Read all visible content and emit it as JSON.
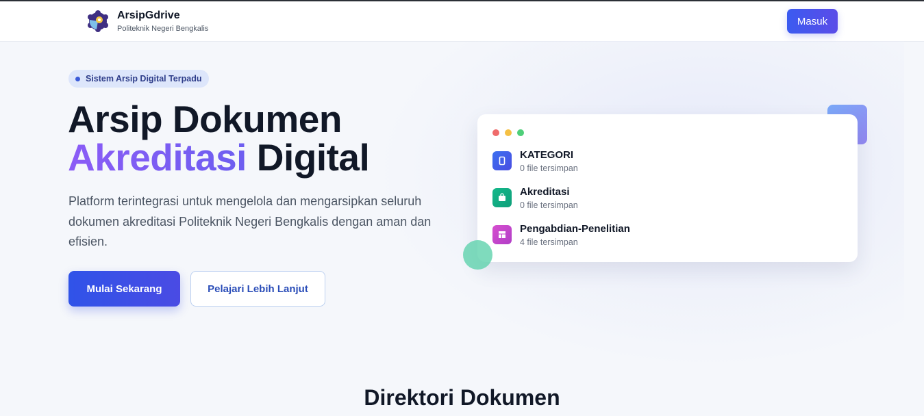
{
  "header": {
    "brand_title": "ArsipGdrive",
    "brand_subtitle": "Politeknik Negeri Bengkalis",
    "login_label": "Masuk"
  },
  "hero": {
    "badge": "Sistem Arsip Digital Terpadu",
    "title_line1": "Arsip Dokumen",
    "title_accent": "Akreditasi",
    "title_line2_rest": "Digital",
    "description": "Platform terintegrasi untuk mengelola dan mengarsipkan seluruh dokumen akreditasi Politeknik Negeri Bengkalis dengan aman dan efisien.",
    "primary_cta": "Mulai Sekarang",
    "secondary_cta": "Pelajari Lebih Lanjut"
  },
  "preview_card": {
    "items": [
      {
        "name": "KATEGORI",
        "count": "0 file tersimpan",
        "icon": "mobile-icon",
        "color": "#3b6ff0"
      },
      {
        "name": "Akreditasi",
        "count": "0 file tersimpan",
        "icon": "shopping-bag-icon",
        "color": "#14b88a"
      },
      {
        "name": "Pengabdian-Penelitian",
        "count": "4 file tersimpan",
        "icon": "layout-icon",
        "color": "#d64fcf"
      }
    ]
  },
  "section": {
    "title": "Direktori Dokumen"
  },
  "colors": {
    "primary": "#3b5bf0",
    "accent": "#8b5cf6"
  }
}
